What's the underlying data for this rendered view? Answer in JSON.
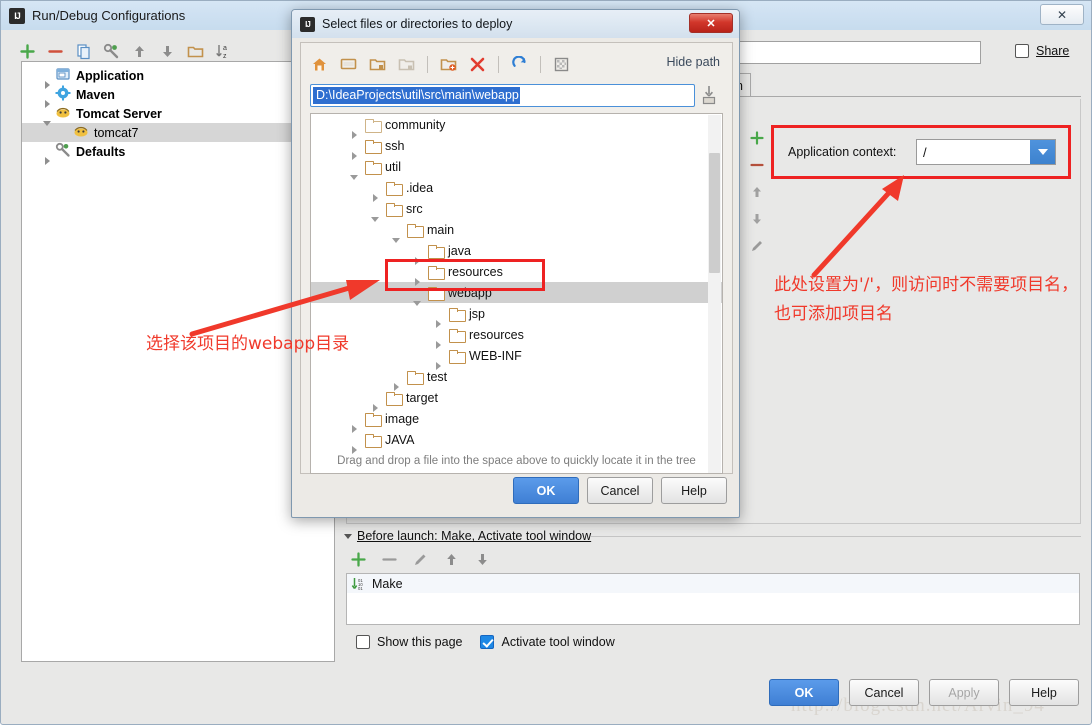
{
  "main_window": {
    "title": "Run/Debug Configurations",
    "app_icon": "intellij-idea-icon",
    "close_label": "✕",
    "toolbar": [
      {
        "name": "add-configuration-button",
        "glyph": "+"
      },
      {
        "name": "remove-configuration-button",
        "glyph": "−"
      },
      {
        "name": "copy-configuration-button",
        "glyph": "copy-icon"
      },
      {
        "name": "edit-defaults-button",
        "glyph": "wrench-icon"
      },
      {
        "name": "move-up-button",
        "glyph": "▲"
      },
      {
        "name": "move-down-button",
        "glyph": "▼"
      },
      {
        "name": "create-folder-button",
        "glyph": "folder-icon"
      },
      {
        "name": "sort-configurations-button",
        "glyph": "sort-az-icon"
      }
    ],
    "config_tree": [
      {
        "label": "Application",
        "icon": "application-icon",
        "expander": "closed",
        "bold": true,
        "indent": 0,
        "selected": false
      },
      {
        "label": "Maven",
        "icon": "maven-icon",
        "expander": "closed",
        "bold": true,
        "indent": 0,
        "selected": false
      },
      {
        "label": "Tomcat Server",
        "icon": "tomcat-icon",
        "expander": "open",
        "bold": true,
        "indent": 0,
        "selected": false
      },
      {
        "label": "tomcat7",
        "icon": "tomcat-icon",
        "expander": "none",
        "bold": false,
        "indent": 1,
        "selected": true
      },
      {
        "label": "Defaults",
        "icon": "wrench-icon",
        "expander": "closed",
        "bold": true,
        "indent": 0,
        "selected": false
      }
    ],
    "name_field_value": "",
    "share": {
      "label": "Share",
      "checked": false
    },
    "tab_label": "on",
    "vtoolbar": [
      {
        "name": "add-artifact-button",
        "glyph": "+"
      },
      {
        "name": "remove-artifact-button",
        "glyph": "−"
      },
      {
        "name": "move-artifact-up-button",
        "glyph": "▲"
      },
      {
        "name": "move-artifact-down-button",
        "glyph": "▼"
      },
      {
        "name": "edit-artifact-button",
        "glyph": "pencil-icon"
      }
    ],
    "application_context": {
      "label": "Application context:",
      "value": "/"
    },
    "annotation_right": "此处设置为'/'，则访问时不需要项目名，也可添加项目名",
    "before_launch": {
      "header": "Before launch: Make, Activate tool window",
      "toolbar": [
        {
          "name": "add-task-button",
          "glyph": "+"
        },
        {
          "name": "remove-task-button",
          "glyph": "−"
        },
        {
          "name": "edit-task-button",
          "glyph": "pencil-icon"
        },
        {
          "name": "move-task-up-button",
          "glyph": "▲"
        },
        {
          "name": "move-task-down-button",
          "glyph": "▼"
        }
      ],
      "items": [
        {
          "label": "Make",
          "icon": "make-icon"
        }
      ],
      "show_this_page": {
        "label": "Show this page",
        "checked": false
      },
      "activate_tool_window": {
        "label": "Activate tool window",
        "checked": true
      }
    },
    "buttons": [
      {
        "label": "OK",
        "name": "ok-button",
        "style": "primary"
      },
      {
        "label": "Cancel",
        "name": "cancel-button",
        "style": "default"
      },
      {
        "label": "Apply",
        "name": "apply-button",
        "style": "disabled"
      },
      {
        "label": "Help",
        "name": "help-button",
        "style": "default"
      }
    ],
    "watermark": "http://blog.csdn.net/Arvin_94"
  },
  "file_dialog": {
    "title": "Select files or directories to deploy",
    "app_icon": "intellij-idea-icon",
    "close_label": "✕",
    "toolbar": [
      {
        "name": "home-directory-icon",
        "glyph": "home"
      },
      {
        "name": "desktop-directory-icon",
        "glyph": "desktop"
      },
      {
        "name": "project-directory-icon",
        "glyph": "project"
      },
      {
        "name": "module-directory-icon",
        "glyph": "module"
      },
      {
        "name": "new-folder-icon",
        "glyph": "new-folder"
      },
      {
        "name": "delete-icon",
        "glyph": "delete"
      },
      {
        "name": "refresh-icon",
        "glyph": "refresh"
      },
      {
        "name": "show-hidden-files-icon",
        "glyph": "hidden"
      }
    ],
    "hide_path_label": "Hide path",
    "path_value": "D:\\IdeaProjects\\util\\src\\main\\webapp",
    "paste_icon": "paste-icon",
    "tree": [
      {
        "label": "community",
        "indent": 1,
        "expander": "closed",
        "selected": false,
        "pale": true
      },
      {
        "label": "ssh",
        "indent": 1,
        "expander": "closed",
        "selected": false,
        "pale": false
      },
      {
        "label": "util",
        "indent": 1,
        "expander": "open",
        "selected": false,
        "pale": false
      },
      {
        "label": ".idea",
        "indent": 2,
        "expander": "closed",
        "selected": false,
        "pale": false
      },
      {
        "label": "src",
        "indent": 2,
        "expander": "open",
        "selected": false,
        "pale": false
      },
      {
        "label": "main",
        "indent": 3,
        "expander": "open",
        "selected": false,
        "pale": false
      },
      {
        "label": "java",
        "indent": 4,
        "expander": "closed",
        "selected": false,
        "pale": false
      },
      {
        "label": "resources",
        "indent": 4,
        "expander": "closed",
        "selected": false,
        "pale": false
      },
      {
        "label": "webapp",
        "indent": 4,
        "expander": "open",
        "selected": true,
        "pale": false
      },
      {
        "label": "jsp",
        "indent": 5,
        "expander": "closed",
        "selected": false,
        "pale": false
      },
      {
        "label": "resources",
        "indent": 5,
        "expander": "closed",
        "selected": false,
        "pale": false
      },
      {
        "label": "WEB-INF",
        "indent": 5,
        "expander": "closed",
        "selected": false,
        "pale": false
      },
      {
        "label": "test",
        "indent": 3,
        "expander": "closed",
        "selected": false,
        "pale": false
      },
      {
        "label": "target",
        "indent": 2,
        "expander": "closed",
        "selected": false,
        "pale": false
      },
      {
        "label": "image",
        "indent": 1,
        "expander": "closed",
        "selected": false,
        "pale": false
      },
      {
        "label": "JAVA",
        "indent": 1,
        "expander": "closed",
        "selected": false,
        "pale": false
      }
    ],
    "drag_hint": "Drag and drop a file into the space above to quickly locate it in the tree",
    "buttons": [
      {
        "label": "OK",
        "name": "dialog-ok-button",
        "style": "primary"
      },
      {
        "label": "Cancel",
        "name": "dialog-cancel-button",
        "style": "default"
      },
      {
        "label": "Help",
        "name": "dialog-help-button",
        "style": "default"
      }
    ],
    "annotation_left": "选择该项目的webapp目录"
  },
  "colors": {
    "annotation_red": "#f0392b",
    "highlight_border": "#ee2222",
    "accent_blue": "#3f7fd4",
    "folder_gold": "#c2914c"
  }
}
